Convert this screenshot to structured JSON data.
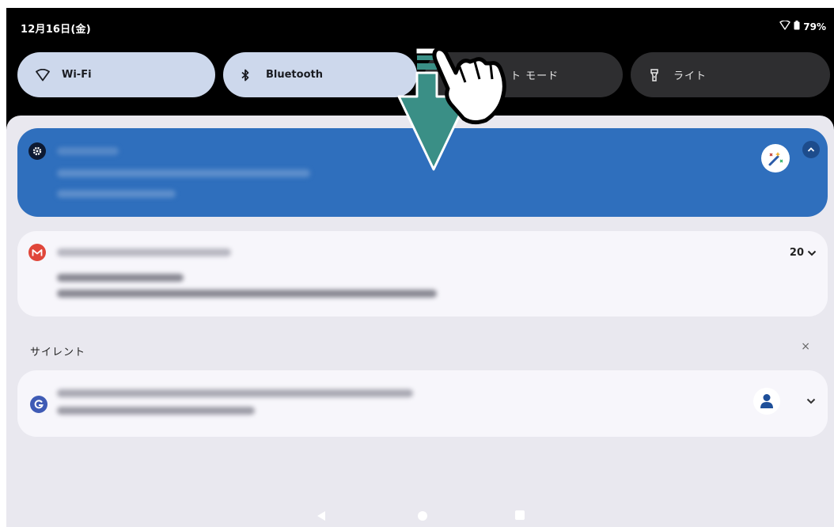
{
  "status_bar": {
    "date": "12月16日(金)",
    "battery": "79%",
    "icons": [
      "wifi-icon",
      "battery-icon"
    ]
  },
  "quick_settings": {
    "tiles": [
      {
        "label": "Wi-Fi",
        "icon": "wifi-icon",
        "state": "on"
      },
      {
        "label": "Bluetooth",
        "icon": "bluetooth-icon",
        "state": "on"
      },
      {
        "label": "ト モード",
        "icon": "",
        "state": "off"
      },
      {
        "label": "ライト",
        "icon": "flashlight-icon",
        "state": "off"
      }
    ]
  },
  "notifications": {
    "gmail_count": "20",
    "silent_label": "サイレント",
    "clear_label": "×"
  },
  "colors": {
    "tile_on": "#cdd8ec",
    "tile_off": "#2e2e30",
    "highlight_notification": "#2f6fbd",
    "gesture_arrow": "#3a8f86",
    "shade_bg": "#e9e8ef"
  },
  "overlay": {
    "gesture": "swipe-down",
    "icons": [
      "down-arrow-icon",
      "pointing-hand-icon"
    ]
  }
}
